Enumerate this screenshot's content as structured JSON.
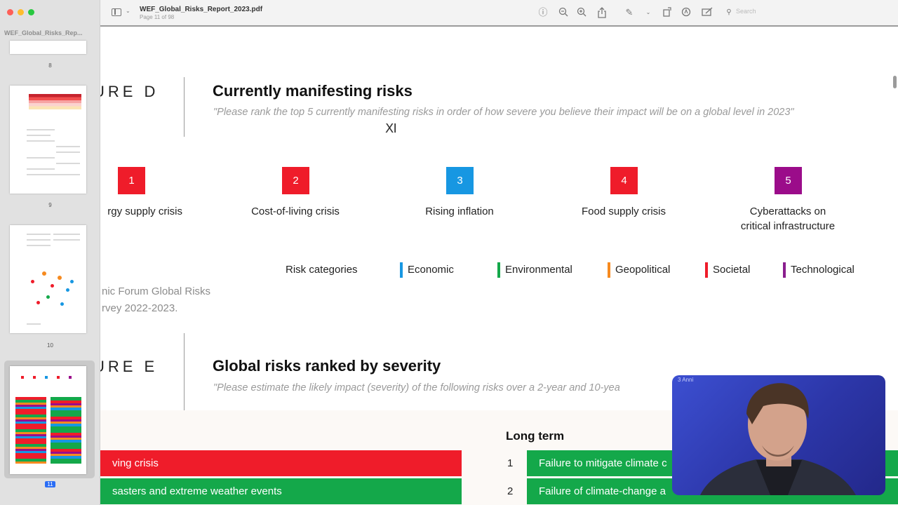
{
  "window": {
    "file_name": "WEF_Global_Risks_Report_2023.pdf",
    "page_info": "Page 11 of 98",
    "search_placeholder": "Search",
    "sidebar_title": "WEF_Global_Risks_Rep..."
  },
  "thumbnails": [
    {
      "page": "8"
    },
    {
      "page": "9"
    },
    {
      "page": "10"
    },
    {
      "page": "11",
      "selected": true
    }
  ],
  "toolbar_icons": [
    "info-icon",
    "zoom-out-icon",
    "zoom-in-icon",
    "share-icon",
    "markup-pen-icon",
    "chevron-down-icon",
    "rotate-icon",
    "annotate-icon",
    "form-fill-icon",
    "search-icon"
  ],
  "figure_d": {
    "label": "URE D",
    "title": "Currently manifesting risks",
    "quote": "\"Please rank the top 5 currently manifesting risks in order of how severe you believe their impact will be on a global level in 2023\"",
    "risks": [
      {
        "rank": "1",
        "label": "rgy supply crisis",
        "color": "#ef1c2a"
      },
      {
        "rank": "2",
        "label": "Cost-of-living crisis",
        "color": "#ef1c2a"
      },
      {
        "rank": "3",
        "label": "Rising inflation",
        "color": "#1797e2"
      },
      {
        "rank": "4",
        "label": "Food supply crisis",
        "color": "#ef1c2a"
      },
      {
        "rank": "5",
        "label_line1": "Cyberattacks on",
        "label_line2": "critical infrastructure",
        "color": "#9b0c8a"
      }
    ],
    "legend": {
      "title": "Risk categories",
      "items": [
        {
          "label": "Economic",
          "color": "#1797e2"
        },
        {
          "label": "Environmental",
          "color": "#14a84a"
        },
        {
          "label": "Geopolitical",
          "color": "#f68a1f"
        },
        {
          "label": "Societal",
          "color": "#ef1c2a"
        },
        {
          "label": "Technological",
          "color": "#8a1e8e"
        }
      ]
    },
    "source_line1": "nic Forum Global Risks",
    "source_line2": "rvey 2022-2023."
  },
  "figure_e": {
    "label": "URE E",
    "title": "Global risks ranked by severity",
    "quote": "\"Please estimate the likely impact (severity) of the following risks over a 2-year and 10-yea",
    "short_term": [
      {
        "label": "ving crisis",
        "color": "#ef1c2a"
      },
      {
        "label": "sasters and extreme weather events",
        "color": "#14a84a"
      }
    ],
    "long_term_title": "Long term",
    "long_term": [
      {
        "num": "1",
        "label": "Failure to mitigate climate c",
        "color": "#14a84a"
      },
      {
        "num": "2",
        "label": "Failure of climate-change a",
        "color": "#14a84a"
      }
    ]
  },
  "webcam": {
    "tag": "3 Anni"
  }
}
